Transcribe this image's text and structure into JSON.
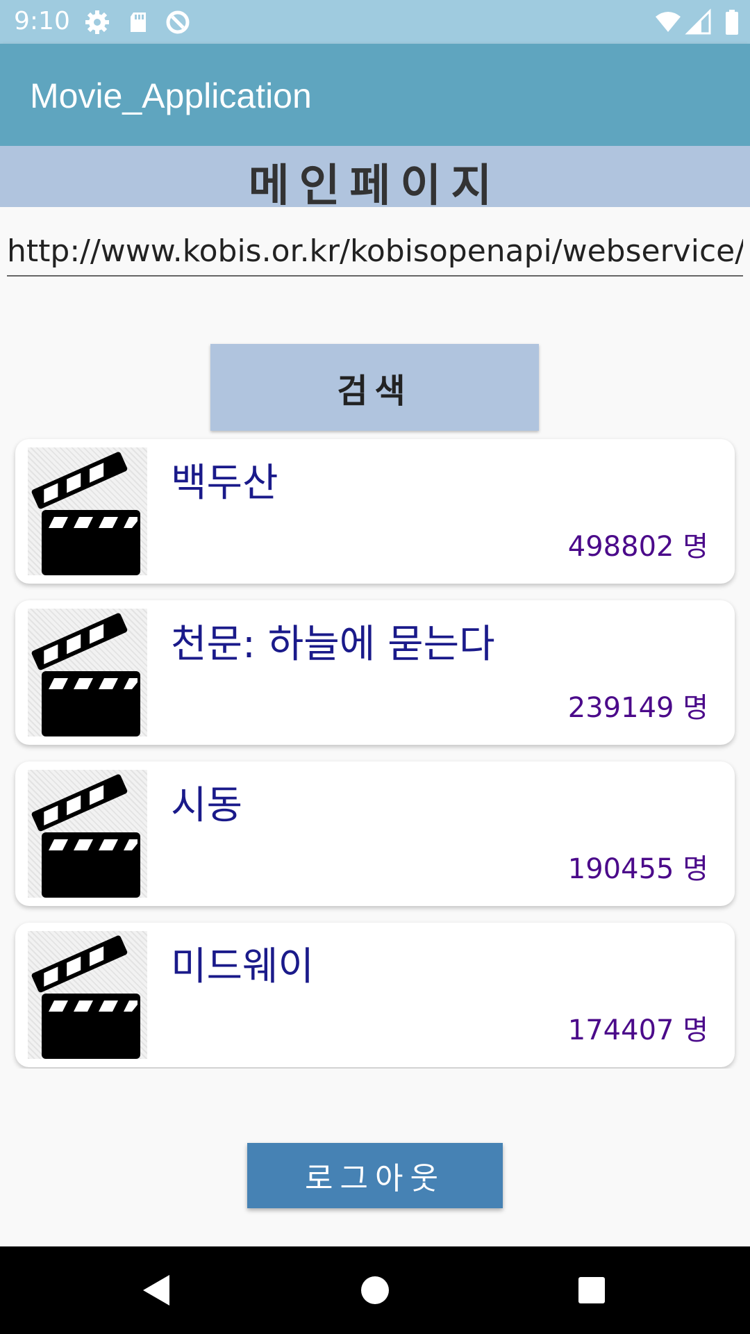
{
  "status_bar": {
    "time": "9:10",
    "icons": [
      "gear-icon",
      "sd-card-icon",
      "sync-icon",
      "wifi-icon",
      "signal-icon",
      "battery-icon"
    ]
  },
  "app_bar": {
    "title": "Movie_Application"
  },
  "page_header": {
    "title": "메인페이지"
  },
  "url_input": {
    "value": "http://www.kobis.or.kr/kobisopenapi/webservice/rest/boxoffice/searchDailyBoxOfficeList"
  },
  "search_button": {
    "label": "검색"
  },
  "movies": [
    {
      "title": "백두산",
      "audience": "498802 명",
      "icon": "clapperboard-icon"
    },
    {
      "title": "천문: 하늘에 묻는다",
      "audience": "239149 명",
      "icon": "clapperboard-icon"
    },
    {
      "title": "시동",
      "audience": "190455 명",
      "icon": "clapperboard-icon"
    },
    {
      "title": "미드웨이",
      "audience": "174407 명",
      "icon": "clapperboard-icon"
    }
  ],
  "logout_button": {
    "label": "로그아웃"
  },
  "nav_bar": {
    "icons": [
      "back-icon",
      "home-icon",
      "recents-icon"
    ]
  },
  "colors": {
    "status_bar": "#9fcbdf",
    "app_bar": "#5fa5bf",
    "header": "#b0c4de",
    "movie_title": "#1a1a8a",
    "audience": "#4b0a8a",
    "logout": "#4682b4"
  }
}
